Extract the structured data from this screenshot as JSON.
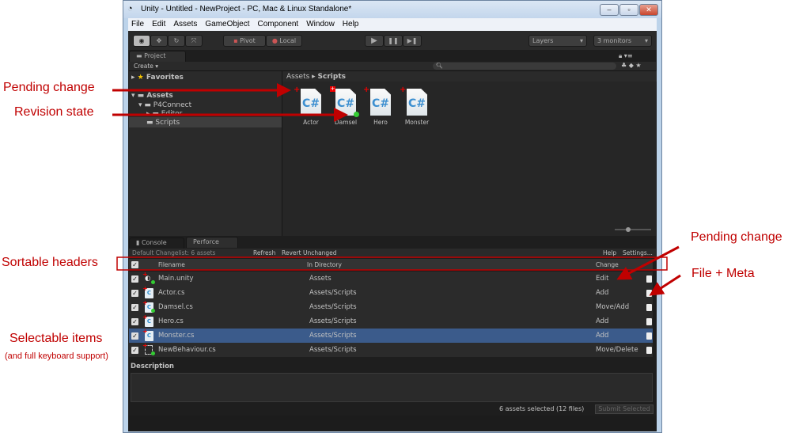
{
  "window": {
    "title": "Unity - Untitled - NewProject - PC, Mac & Linux Standalone*",
    "buttons": [
      "‒",
      "▫",
      "✕"
    ]
  },
  "menu": [
    "File",
    "Edit",
    "Assets",
    "GameObject",
    "Component",
    "Window",
    "Help"
  ],
  "toolbar": {
    "pivot": "Pivot",
    "local": "Local",
    "play": "▶",
    "pause": "❚❚",
    "step": "▶❚",
    "layers": "Layers",
    "layout": "3 monitors"
  },
  "project": {
    "tab": "Project",
    "create": "Create",
    "favorites": "Favorites",
    "tree": [
      "Assets",
      "P4Connect",
      "Editor",
      "Scripts"
    ],
    "breadcrumb": {
      "root": "Assets",
      "current": "Scripts"
    },
    "assets": [
      {
        "name": "Actor",
        "state": "add"
      },
      {
        "name": "Damsel",
        "state": "move-add"
      },
      {
        "name": "Hero",
        "state": "add"
      },
      {
        "name": "Monster",
        "state": "add"
      }
    ],
    "icon_text": "C#"
  },
  "perforce": {
    "tabs": [
      "Console",
      "Perforce"
    ],
    "changelist": "Default Changelist: 6 assets",
    "refresh": "Refresh",
    "revert": "Revert Unchanged",
    "help": "Help",
    "settings": "Settings...",
    "columns": [
      "Filename",
      "In Directory",
      "Change"
    ],
    "rows": [
      {
        "file": "Main.unity",
        "dir": "Assets",
        "change": "Edit",
        "selected": false
      },
      {
        "file": "Actor.cs",
        "dir": "Assets/Scripts",
        "change": "Add",
        "selected": false
      },
      {
        "file": "Damsel.cs",
        "dir": "Assets/Scripts",
        "change": "Move/Add",
        "selected": false
      },
      {
        "file": "Hero.cs",
        "dir": "Assets/Scripts",
        "change": "Add",
        "selected": false
      },
      {
        "file": "Monster.cs",
        "dir": "Assets/Scripts",
        "change": "Add",
        "selected": true
      },
      {
        "file": "NewBehaviour.cs",
        "dir": "Assets/Scripts",
        "change": "Move/Delete",
        "selected": false
      }
    ],
    "description_label": "Description",
    "status": "6 assets selected (12 files)",
    "submit": "Submit Selected"
  },
  "annotations": {
    "pending_change": "Pending change",
    "revision_state": "Revision state",
    "sortable_headers": "Sortable headers",
    "pending_change_2": "Pending change",
    "file_meta": "File + Meta",
    "selectable": "Selectable items",
    "keyboard": "(and full keyboard support)"
  },
  "colors": {
    "annotation": "#c00000",
    "selection": "#3b5b8b"
  }
}
